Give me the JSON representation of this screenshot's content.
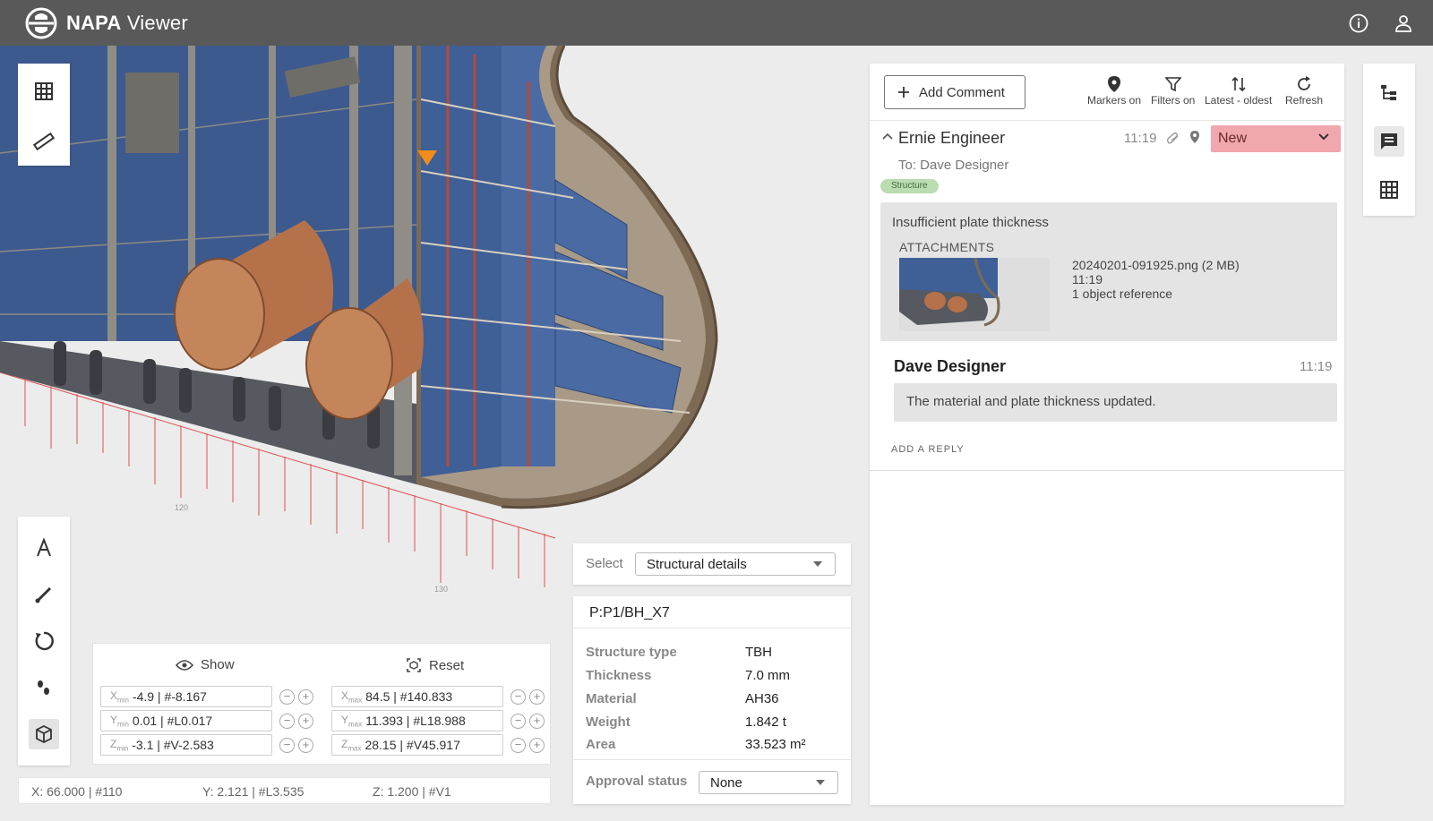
{
  "app": {
    "brand_bold": "NAPA",
    "brand_light": "Viewer"
  },
  "header": {
    "icons": [
      "info-icon",
      "user-icon"
    ]
  },
  "viewport": {
    "grid_labels": [
      "120",
      "130"
    ],
    "left_toolbar_top": [
      "grid-icon",
      "ruler-icon"
    ],
    "left_toolbar_bottom": [
      "text-icon",
      "brush-icon",
      "rotate-icon",
      "walk-icon",
      "cube-icon"
    ]
  },
  "clip_box": {
    "show_label": "Show",
    "reset_label": "Reset",
    "xmin": {
      "label": "X",
      "sub": "min",
      "value": "-4.9 | #-8.167"
    },
    "ymin": {
      "label": "Y",
      "sub": "min",
      "value": "0.01 | #L0.017"
    },
    "zmin": {
      "label": "Z",
      "sub": "min",
      "value": "-3.1 | #V-2.583"
    },
    "xmax": {
      "label": "X",
      "sub": "max",
      "value": "84.5 | #140.833"
    },
    "ymax": {
      "label": "Y",
      "sub": "max",
      "value": "11.393 | #L18.988"
    },
    "zmax": {
      "label": "Z",
      "sub": "max",
      "value": "28.15 | #V45.917"
    }
  },
  "coords": {
    "x": "X: 66.000 | #110",
    "y": "Y: 2.121 | #L3.535",
    "z": "Z: 1.200 | #V1"
  },
  "select": {
    "label": "Select",
    "value": "Structural details"
  },
  "properties": {
    "title": "P:P1/BH_X7",
    "rows": [
      {
        "key": "Structure type",
        "value": "TBH"
      },
      {
        "key": "Thickness",
        "value": "7.0 mm"
      },
      {
        "key": "Material",
        "value": "AH36"
      },
      {
        "key": "Weight",
        "value": "1.842 t"
      },
      {
        "key": "Area",
        "value": "33.523 m²"
      }
    ],
    "approval_label": "Approval status",
    "approval_value": "None"
  },
  "comments": {
    "add_comment_label": "Add Comment",
    "toolbar": [
      {
        "icon": "marker-icon",
        "label": "Markers on"
      },
      {
        "icon": "filter-icon",
        "label": "Filters on"
      },
      {
        "icon": "sort-icon",
        "label": "Latest - oldest"
      },
      {
        "icon": "refresh-icon",
        "label": "Refresh"
      }
    ],
    "thread": {
      "author": "Ernie Engineer",
      "time": "11:19",
      "status": "New",
      "to": "To: Dave Designer",
      "tag": "Structure",
      "message": "Insufficient plate thickness",
      "attachments_label": "ATTACHMENTS",
      "attachment": {
        "filename": "20240201-091925.png (2 MB)",
        "time": "11:19",
        "refs": "1 object reference"
      }
    },
    "reply": {
      "author": "Dave Designer",
      "time": "11:19",
      "message": "The material and plate thickness updated."
    },
    "add_reply_label": "ADD A REPLY"
  },
  "right_rail": [
    "tree-icon",
    "comments-icon",
    "table-icon"
  ],
  "colors": {
    "header": "#595959",
    "status_new": "#f0a7ad",
    "tag_green": "#b9ddb0",
    "marker_orange": "#f28c1c",
    "hull_blue": "#3f5f97",
    "pipe_copper": "#b5724a"
  }
}
